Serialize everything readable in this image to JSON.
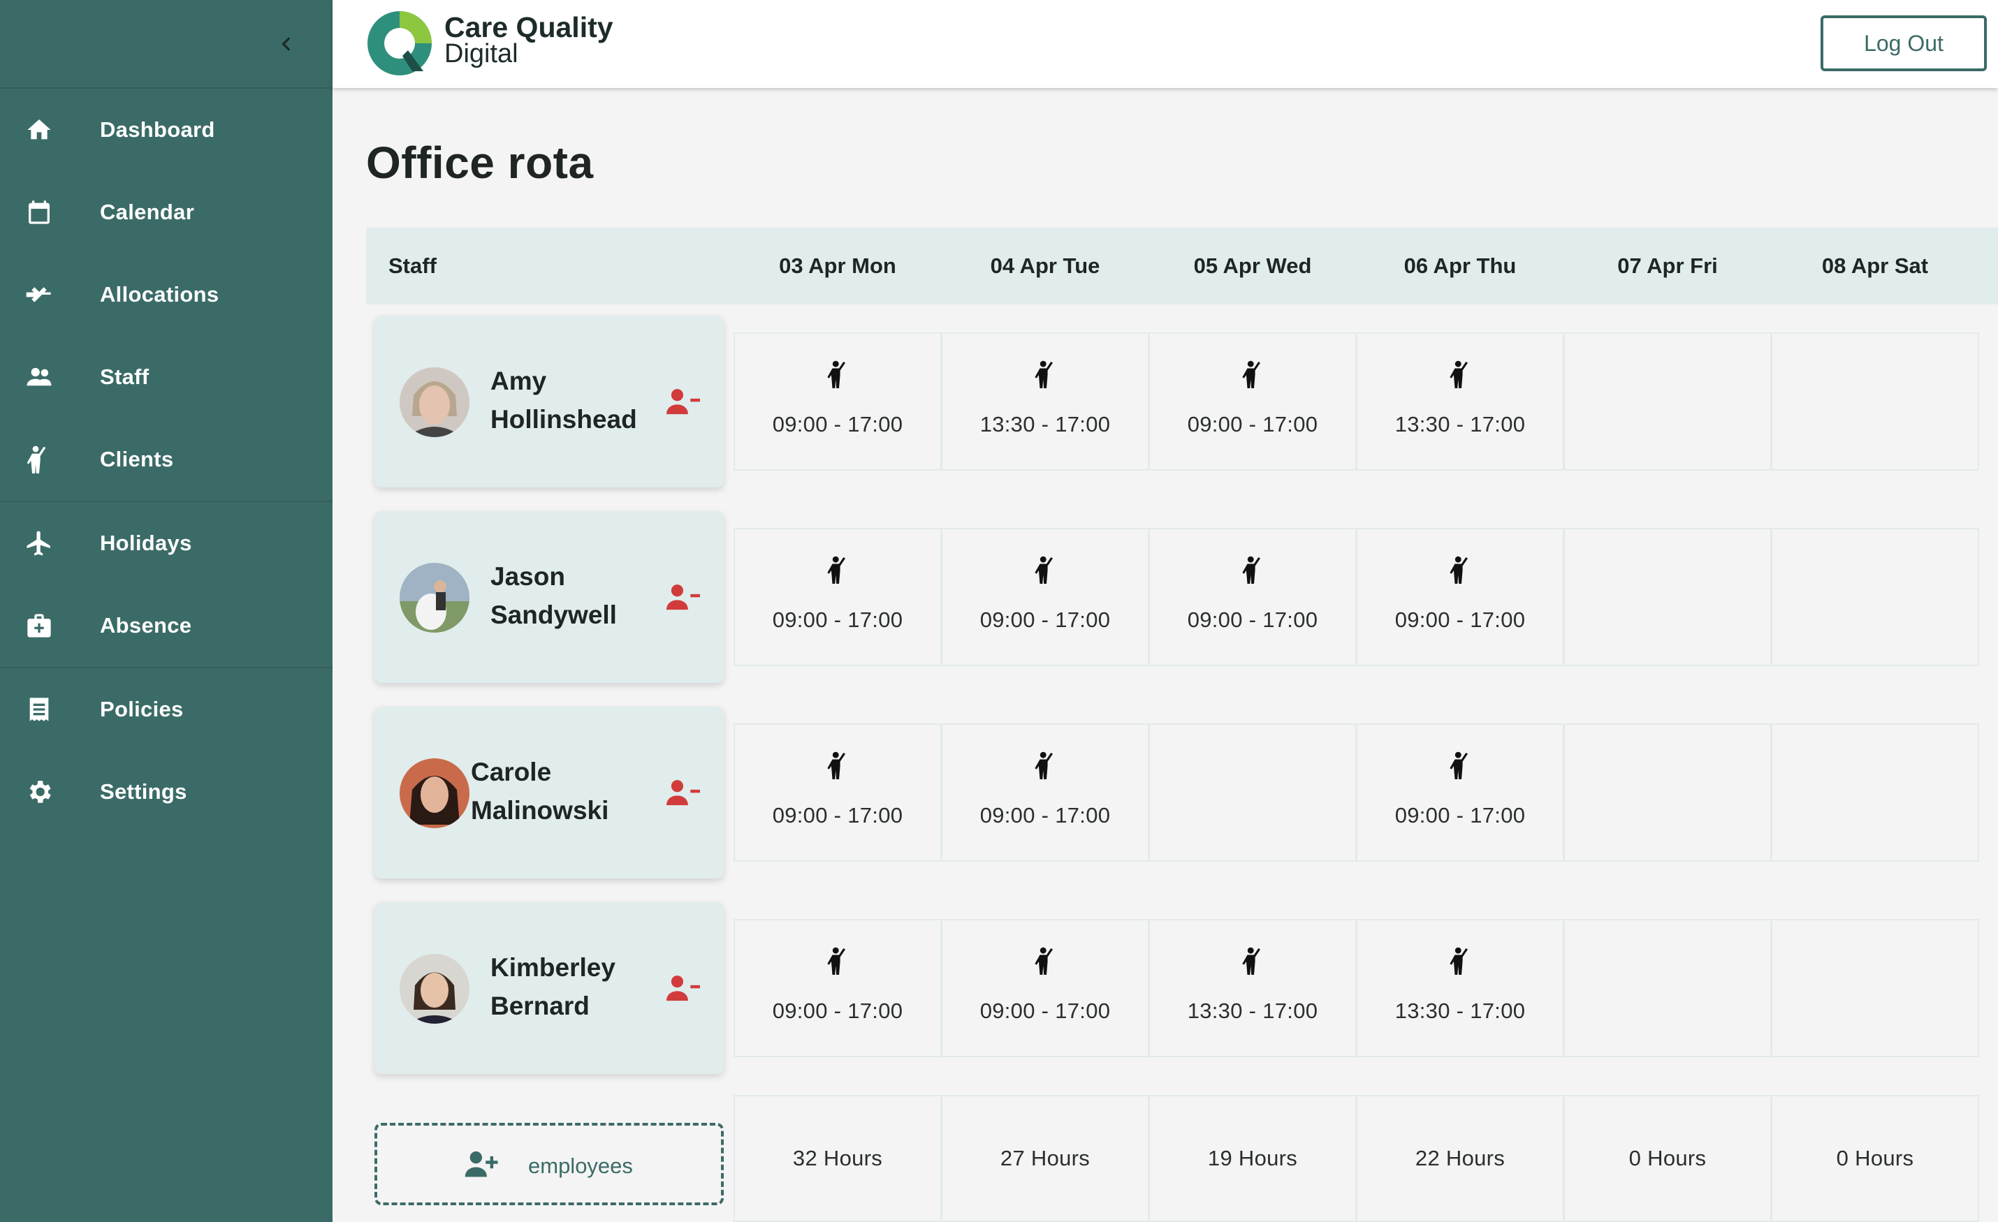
{
  "brand": {
    "line1": "Care Quality",
    "line2": "Digital",
    "color": "#2f8f7d"
  },
  "header": {
    "logout_label": "Log Out"
  },
  "sidebar": {
    "items": [
      {
        "label": "Dashboard",
        "icon": "home-icon"
      },
      {
        "label": "Calendar",
        "icon": "calendar-icon"
      },
      {
        "label": "Allocations",
        "icon": "swap-arrows-icon"
      },
      {
        "label": "Staff",
        "icon": "people-icon"
      },
      {
        "label": "Clients",
        "icon": "person-waving-icon"
      },
      {
        "label": "Holidays",
        "icon": "airplane-icon"
      },
      {
        "label": "Absence",
        "icon": "medical-bag-icon"
      },
      {
        "label": "Policies",
        "icon": "document-icon"
      },
      {
        "label": "Settings",
        "icon": "gear-icon"
      }
    ]
  },
  "page": {
    "title": "Office rota"
  },
  "table": {
    "staff_header": "Staff",
    "days": [
      "03 Apr Mon",
      "04 Apr Tue",
      "05 Apr Wed",
      "06 Apr Thu",
      "07 Apr Fri",
      "08 Apr Sat"
    ],
    "staff": [
      {
        "first": "Amy",
        "last": "Hollinshead",
        "shifts": [
          "09:00 - 17:00",
          "13:30 - 17:00",
          "09:00 - 17:00",
          "13:30 - 17:00",
          "",
          ""
        ]
      },
      {
        "first": "Jason",
        "last": "Sandywell",
        "shifts": [
          "09:00 - 17:00",
          "09:00 - 17:00",
          "09:00 - 17:00",
          "09:00 - 17:00",
          "",
          ""
        ]
      },
      {
        "first": "Carole",
        "last": "Malinowski",
        "shifts": [
          "09:00 - 17:00",
          "09:00 - 17:00",
          "",
          "09:00 - 17:00",
          "",
          ""
        ]
      },
      {
        "first": "Kimberley",
        "last": "Bernard",
        "shifts": [
          "09:00 - 17:00",
          "09:00 - 17:00",
          "13:30 - 17:00",
          "13:30 - 17:00",
          "",
          ""
        ]
      }
    ],
    "totals": [
      "32 Hours",
      "27 Hours",
      "19 Hours",
      "22 Hours",
      "0 Hours",
      "0 Hours"
    ],
    "add_employees_label": "employees"
  },
  "colors": {
    "sidebar": "#3b6b67",
    "accent": "#3b6b67",
    "remove": "#d13b3b",
    "header_row": "#e1ecec"
  }
}
